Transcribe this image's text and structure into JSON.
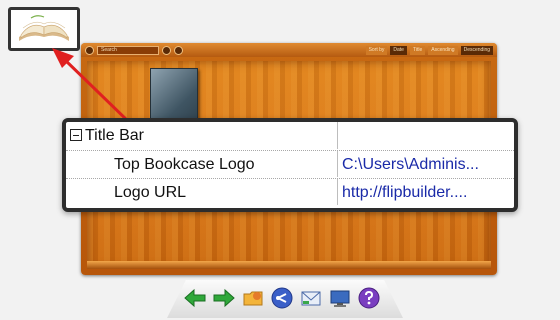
{
  "property_panel": {
    "group": {
      "label": "Title Bar",
      "value": ""
    },
    "rows": [
      {
        "label": "Top Bookcase Logo",
        "value": "C:\\Users\\Adminis..."
      },
      {
        "label": "Logo URL",
        "value": "http://flipbuilder...."
      }
    ]
  },
  "toolbar": {
    "search_label": "Search",
    "buttons": [
      "Sort by",
      "Date",
      "Title",
      "Ascending",
      "Descending"
    ]
  },
  "bottom_icons": [
    "arrow-left-icon",
    "arrow-right-icon",
    "folder-icon",
    "share-icon",
    "email-icon",
    "monitor-icon",
    "help-icon"
  ],
  "colors": {
    "highlight_border": "#2d2d2d",
    "arrow": "#e02020",
    "value_text": "#1a2aa8",
    "bookcase": "#c86a12"
  }
}
